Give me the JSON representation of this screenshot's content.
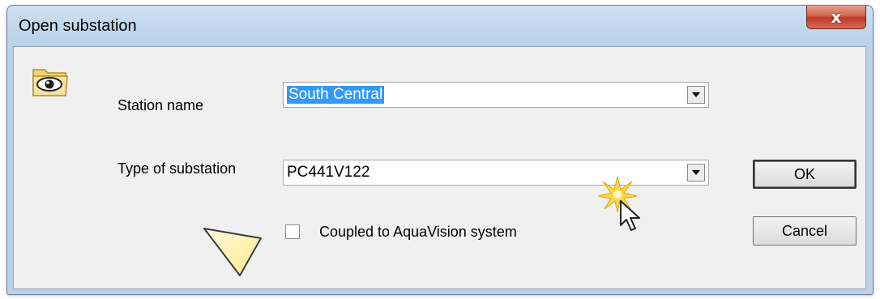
{
  "dialog": {
    "title": "Open substation",
    "close_label": "x"
  },
  "form": {
    "station_name_label": "Station name",
    "station_name_value": "South Central",
    "substation_type_label": "Type of substation",
    "substation_type_value": "PC441V122",
    "coupled_checkbox_label": "Coupled to AquaVision system",
    "coupled_checked": false
  },
  "buttons": {
    "ok": "OK",
    "cancel": "Cancel"
  },
  "icons": {
    "app_icon": "folder-eye-icon",
    "dropdown": "chevron-down-icon",
    "cursor": "mouse-pointer-icon",
    "click_highlight": "click-burst-icon",
    "callout": "callout-arrow-icon"
  },
  "colors": {
    "selection": "#3399ff",
    "close_button": "#c0392b",
    "window_frame": "#b9d1ea",
    "dialog_bg": "#f0f0f0"
  }
}
